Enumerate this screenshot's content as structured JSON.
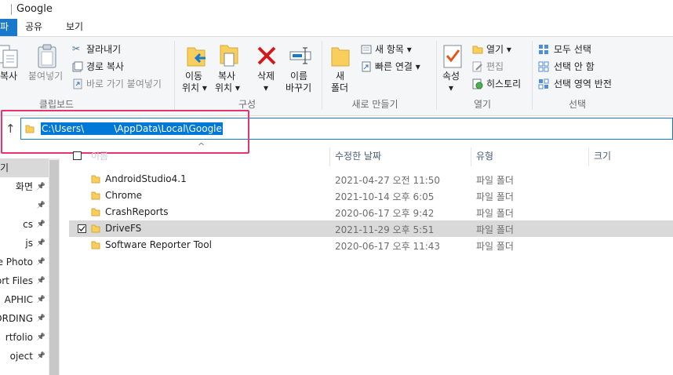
{
  "window": {
    "title": "Google"
  },
  "tabs": {
    "file": "파일",
    "share": "공유",
    "view": "보기"
  },
  "ribbon": {
    "clipboard": {
      "group_label": "클립보드",
      "copy": "복사",
      "paste": "붙여넣기",
      "cut": "잘라내기",
      "copy_path": "경로 복사",
      "paste_shortcut": "바로 가기 붙여넣기"
    },
    "organize": {
      "group_label": "구성",
      "move_to_1": "이동",
      "move_to_2": "위치",
      "copy_to_1": "복사",
      "copy_to_2": "위치",
      "delete": "삭제",
      "rename_1": "이름",
      "rename_2": "바꾸기"
    },
    "new": {
      "group_label": "새로 만들기",
      "new_folder_1": "새",
      "new_folder_2": "폴더",
      "new_item": "새 항목",
      "easy_access": "빠른 연결"
    },
    "open": {
      "group_label": "열기",
      "properties": "속성",
      "open": "열기",
      "edit": "편집",
      "history": "히스토리"
    },
    "select": {
      "group_label": "선택",
      "select_all": "모두 선택",
      "select_none": "선택 안 함",
      "invert": "선택 영역 반전"
    }
  },
  "address": {
    "path": "C:\\Users\\          \\AppData\\Local\\Google"
  },
  "nav": {
    "items": [
      {
        "label": "기",
        "pinned": false,
        "selected": true
      },
      {
        "label": "화면",
        "pinned": true,
        "selected": false
      },
      {
        "label": "",
        "pinned": true,
        "selected": false
      },
      {
        "label": "cs",
        "pinned": true,
        "selected": false
      },
      {
        "label": "js",
        "pinned": true,
        "selected": false
      },
      {
        "label": "pe Photo",
        "pinned": true,
        "selected": false
      },
      {
        "label": "port Files",
        "pinned": true,
        "selected": false
      },
      {
        "label": "APHIC",
        "pinned": true,
        "selected": false
      },
      {
        "label": "ORDING",
        "pinned": true,
        "selected": false
      },
      {
        "label": "rtfolio",
        "pinned": true,
        "selected": false
      },
      {
        "label": "oject",
        "pinned": true,
        "selected": false
      }
    ]
  },
  "list": {
    "columns": {
      "name": "이름",
      "date": "수정한 날짜",
      "type": "유형",
      "size": "크기"
    },
    "rows": [
      {
        "name": "AndroidStudio4.1",
        "date": "2021-04-27 오전 11:50",
        "type": "파일 폴더",
        "selected": false
      },
      {
        "name": "Chrome",
        "date": "2021-10-14 오후 6:05",
        "type": "파일 폴더",
        "selected": false
      },
      {
        "name": "CrashReports",
        "date": "2020-06-17 오후 9:42",
        "type": "파일 폴더",
        "selected": false
      },
      {
        "name": "DriveFS",
        "date": "2021-11-29 오후 5:51",
        "type": "파일 폴더",
        "selected": true
      },
      {
        "name": "Software Reporter Tool",
        "date": "2020-06-17 오후 11:43",
        "type": "파일 폴더",
        "selected": false
      }
    ]
  },
  "colors": {
    "accent": "#1979ca",
    "highlight_box": "#e8336b",
    "selection": "#0078d7",
    "folder": "#f8cf5d"
  }
}
